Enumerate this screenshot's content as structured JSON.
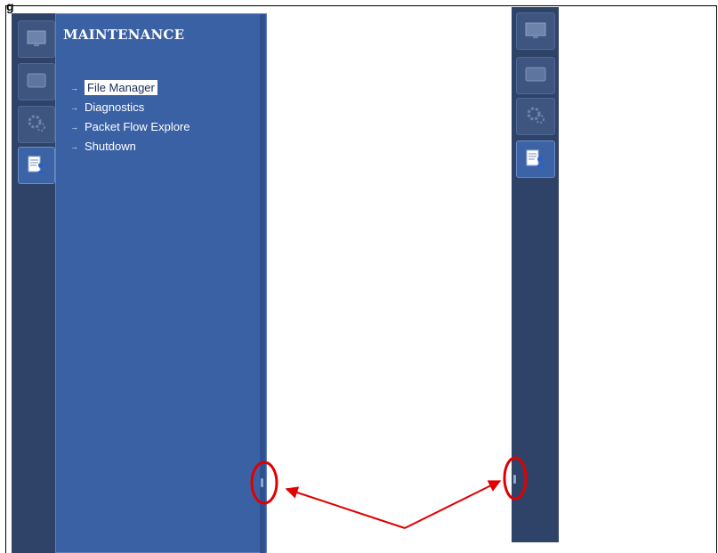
{
  "caption_cut": "g",
  "sidebar": {
    "section_title": "MAINTENANCE",
    "menu": [
      {
        "label": "File Manager",
        "selected": true
      },
      {
        "label": "Diagnostics",
        "selected": false
      },
      {
        "label": "Packet Flow Explore",
        "selected": false
      },
      {
        "label": "Shutdown",
        "selected": false
      }
    ],
    "tabs": [
      {
        "icon": "monitor-icon",
        "active": false
      },
      {
        "icon": "display-icon",
        "active": false
      },
      {
        "icon": "gear-icon",
        "active": false
      },
      {
        "icon": "maintenance-user-icon",
        "active": true
      }
    ]
  },
  "annotations": {
    "highlight_color": "#e00000",
    "arrow_color": "#e00000"
  }
}
